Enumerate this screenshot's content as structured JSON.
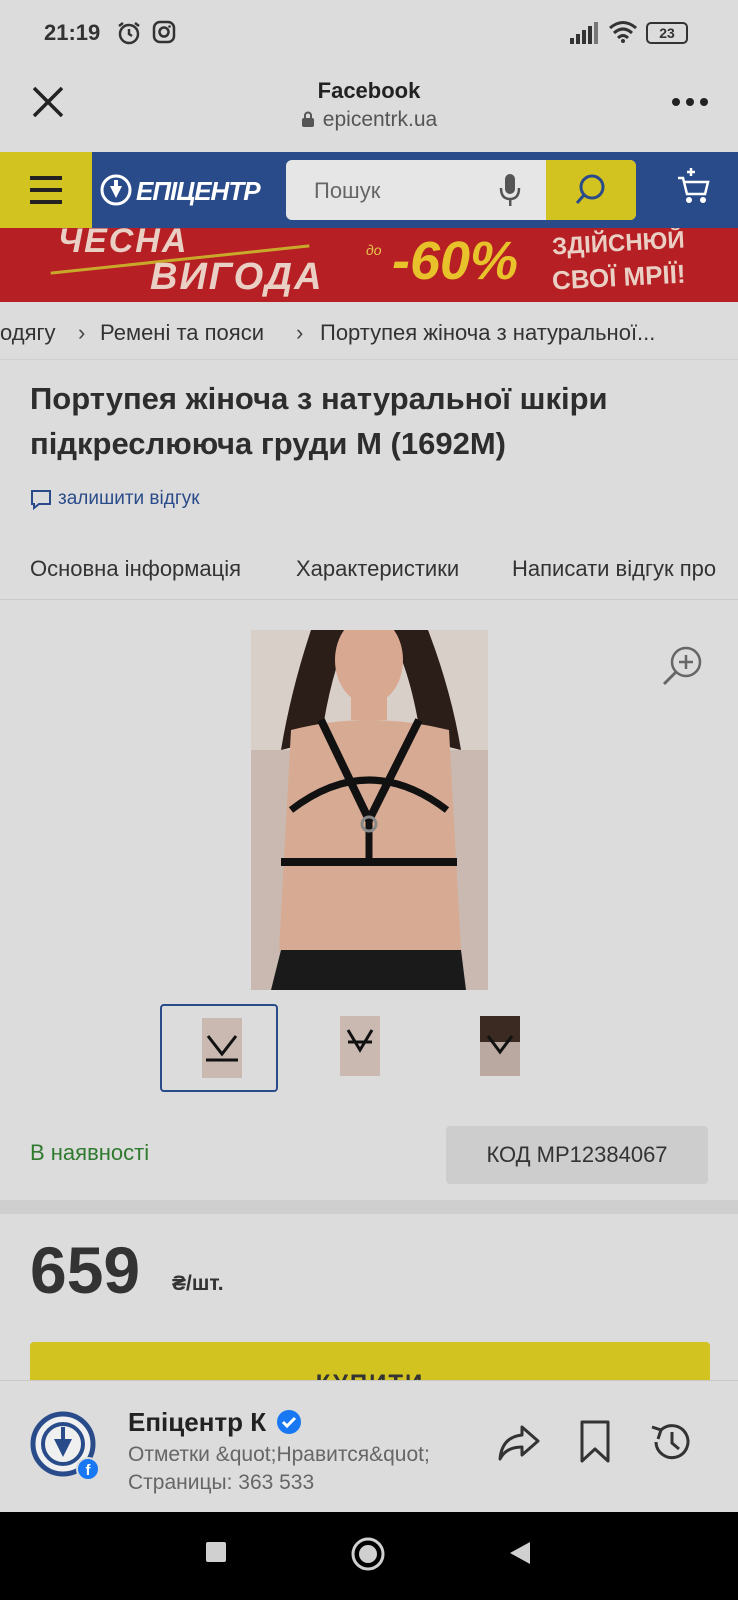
{
  "status_bar": {
    "time": "21:19",
    "battery": "23"
  },
  "browser": {
    "title": "Facebook",
    "url": "epicentrk.ua"
  },
  "site_header": {
    "logo_text": "ЕПІЦЕНТР",
    "search_placeholder": "Пошук"
  },
  "banner": {
    "line1": "ЧЕСНА",
    "line2": "ВИГОДА",
    "small": "до",
    "discount": "-60%",
    "line3": "ЗДІЙСНЮЙ",
    "line4": "СВОЇ МРІЇ!"
  },
  "breadcrumb": [
    "одягу",
    "Ремені та пояси",
    "Портупея жіноча з натуральної..."
  ],
  "product": {
    "title": "Портупея жіноча з натуральної шкіри підкреслююча груди M (1692M)",
    "review_link": "залишити відгук",
    "availability": "В наявності",
    "code": "КОД MP12384067",
    "price": "659",
    "price_unit": "₴/шт.",
    "buy_label": "КУПИТИ"
  },
  "tabs": [
    "Основна інформація",
    "Характеристики",
    "Написати відгук про"
  ],
  "fb_page": {
    "name": "Епіцентр К",
    "likes_line1": "Отметки &quot;Нравится&quot;",
    "likes_line2": "Страницы: 363 533"
  },
  "colors": {
    "brand_blue": "#2a4b8a",
    "brand_yellow": "#d2c321",
    "stock_green": "#2f7a2f",
    "banner_red": "#b61f24"
  }
}
